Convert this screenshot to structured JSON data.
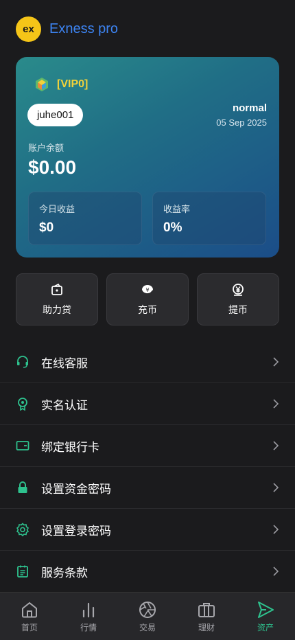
{
  "header": {
    "logo_text": "ex",
    "title": "Exness pro"
  },
  "card": {
    "vip_label": "[VIP0]",
    "username": "juhe001",
    "level": "normal",
    "date": "05 Sep 2025",
    "balance_label": "账户余额",
    "balance_value": "$0.00",
    "stats": [
      {
        "label": "今日收益",
        "value": "$0"
      },
      {
        "label": "收益率",
        "value": "0%"
      }
    ]
  },
  "actions": [
    {
      "label": "助力贷",
      "icon": "wallet-icon"
    },
    {
      "label": "充币",
      "icon": "deposit-icon"
    },
    {
      "label": "提币",
      "icon": "withdraw-icon"
    }
  ],
  "menu": [
    {
      "label": "在线客服",
      "icon": "headset-icon"
    },
    {
      "label": "实名认证",
      "icon": "badge-icon"
    },
    {
      "label": "绑定银行卡",
      "icon": "card-icon"
    },
    {
      "label": "设置资金密码",
      "icon": "lock-icon"
    },
    {
      "label": "设置登录密码",
      "icon": "gear-icon"
    },
    {
      "label": "服务条款",
      "icon": "document-icon"
    }
  ],
  "tabs": [
    {
      "label": "首页",
      "icon": "home-icon"
    },
    {
      "label": "行情",
      "icon": "chart-icon"
    },
    {
      "label": "交易",
      "icon": "aperture-icon"
    },
    {
      "label": "理财",
      "icon": "briefcase-icon"
    },
    {
      "label": "资产",
      "icon": "send-icon",
      "active": true
    }
  ],
  "colors": {
    "accent_green": "#2ec28e",
    "brand_blue": "#3d84f2",
    "vip_gold": "#f2d23a"
  }
}
